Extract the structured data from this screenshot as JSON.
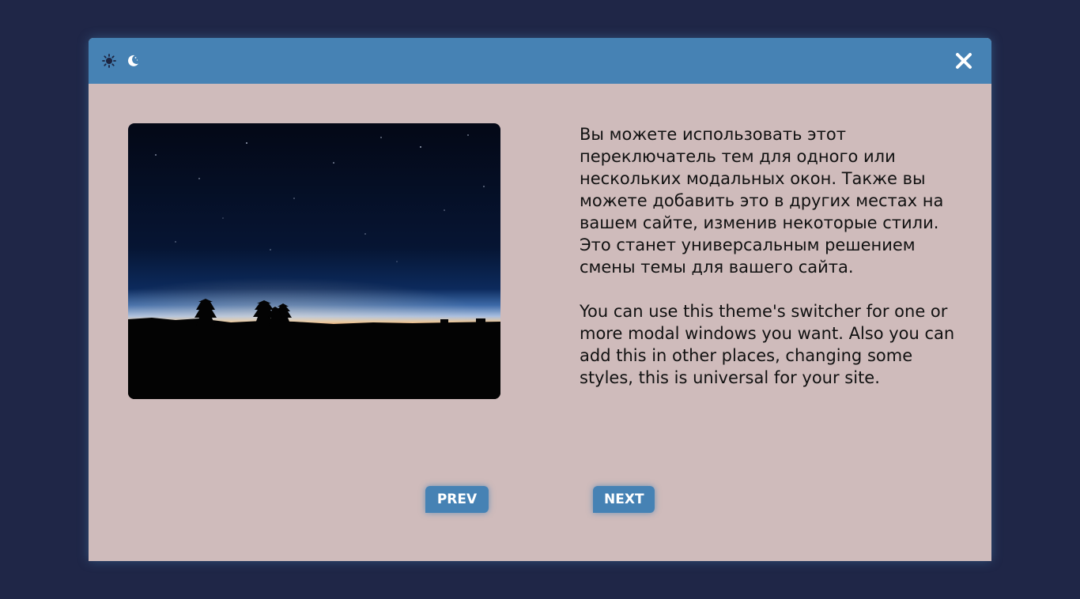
{
  "modal": {
    "header": {
      "theme_icons": [
        "sun-icon",
        "moon-icon"
      ],
      "close_icon": "close-icon",
      "color": "#4682b4"
    },
    "image": {
      "description_icon": "night-sky-photo"
    },
    "text": {
      "ru": "Вы можете использовать этот переключатель тем для одного или нескольких модальных окон. Также вы можете добавить это в других местах на вашем сайте, изменив некоторые стили. Это станет универсальным решением смены темы для вашего сайта.",
      "en": "You can use this theme's switcher for one or more modal windows you want. Also you can add this in other places, changing some styles, this is universal for your site."
    },
    "buttons": {
      "prev_label": "PREV",
      "next_label": "NEXT"
    },
    "colors": {
      "page_background": "#1f2647",
      "modal_background": "#cfbbbb",
      "accent": "#4682b4"
    }
  }
}
